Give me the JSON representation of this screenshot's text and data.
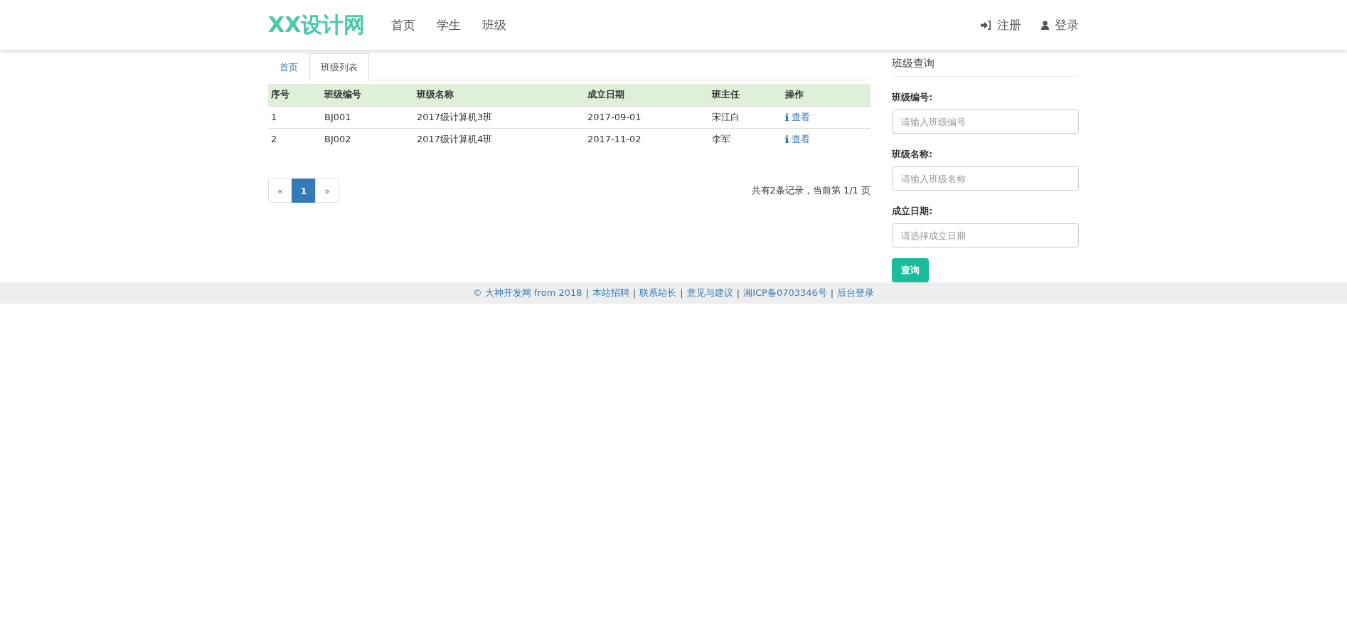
{
  "navbar": {
    "brand": "XX设计网",
    "links": [
      {
        "label": "首页"
      },
      {
        "label": "学生"
      },
      {
        "label": "班级"
      }
    ],
    "actions": [
      {
        "kind": "register",
        "label": "注册"
      },
      {
        "kind": "login",
        "label": "登录"
      }
    ]
  },
  "tabs": [
    {
      "label": "首页",
      "selected": false
    },
    {
      "label": "班级列表",
      "selected": true
    }
  ],
  "table": {
    "columns": [
      "序号",
      "班级编号",
      "班级名称",
      "成立日期",
      "班主任",
      "操作"
    ],
    "rows": [
      {
        "cells": [
          "1",
          "BJ001",
          "2017级计算机3班",
          "2017-09-01",
          "宋江白"
        ],
        "action": "查看"
      },
      {
        "cells": [
          "2",
          "BJ002",
          "2017级计算机4班",
          "2017-11-02",
          "李军"
        ],
        "action": "查看"
      }
    ]
  },
  "pagination": [
    {
      "label": "«",
      "selected": false
    },
    {
      "label": "1",
      "selected": true
    },
    {
      "label": "»",
      "selected": false
    }
  ],
  "record_summary": "共有2条记录，当前第 1/1 页",
  "search_panel": {
    "title": "班级查询",
    "fields": [
      {
        "label": "班级编号:",
        "placeholder": "请输入班级编号"
      },
      {
        "label": "班级名称:",
        "placeholder": "请输入班级名称"
      },
      {
        "label": "成立日期:",
        "placeholder": "请选择成立日期"
      }
    ],
    "button": "查询"
  },
  "footer": {
    "separator": "|",
    "links": [
      "© 大神开发网 from 2018",
      "本站招聘",
      "联系站长",
      "意见与建议",
      "湘ICP备0703346号",
      "后台登录"
    ]
  }
}
